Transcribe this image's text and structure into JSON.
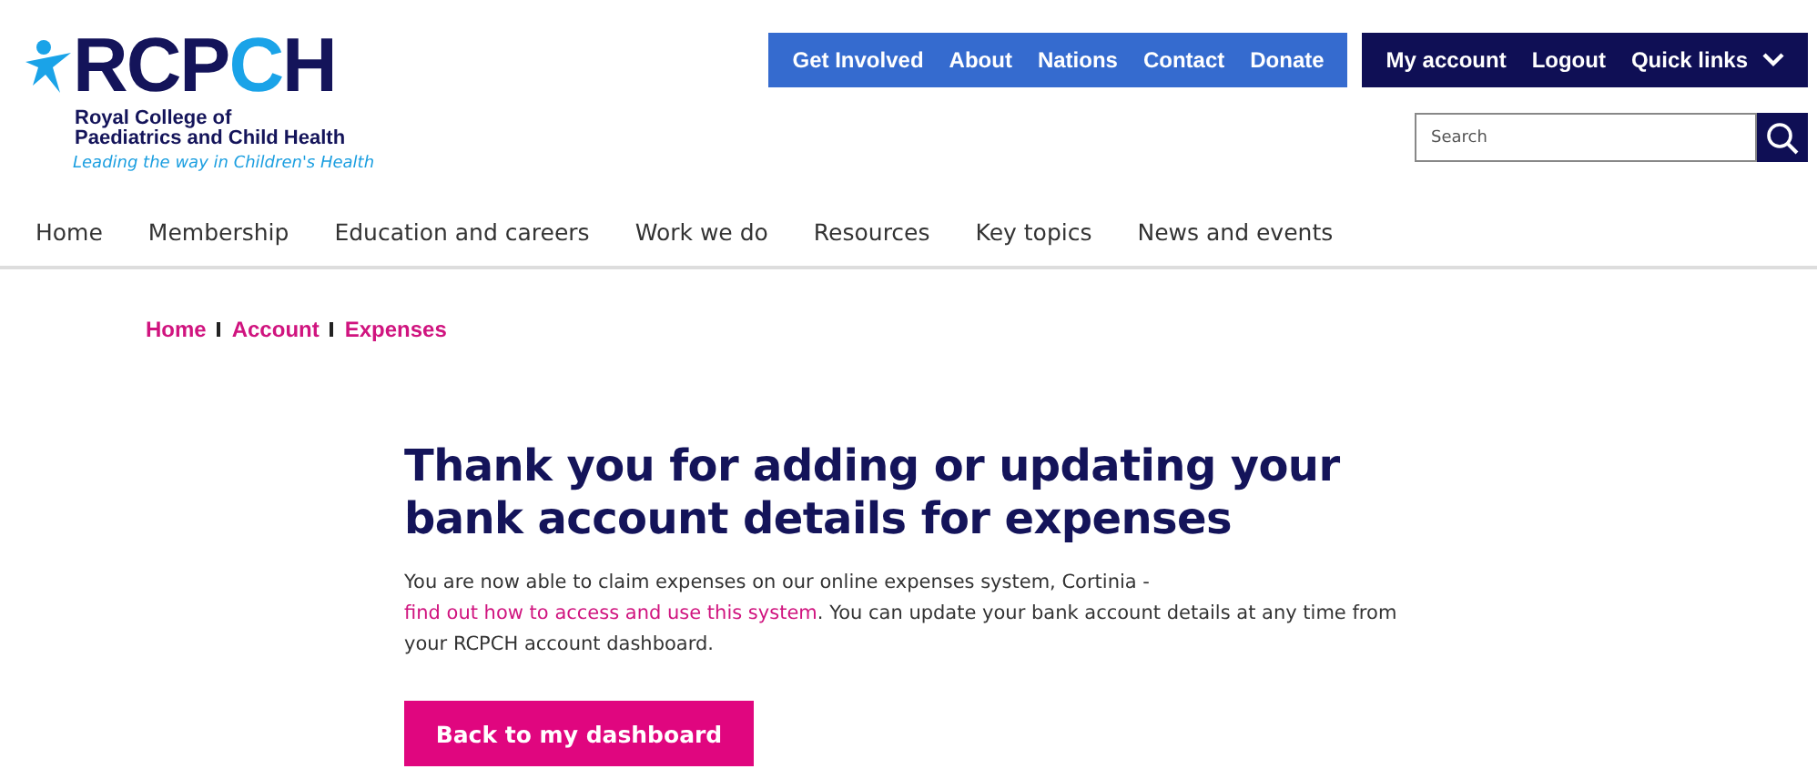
{
  "logo": {
    "letters": [
      {
        "text": "RCP",
        "color": "#14145a"
      },
      {
        "text": "C",
        "color": "#1aa3e8"
      },
      {
        "text": "H",
        "color": "#14145a"
      }
    ],
    "name_lines": [
      "Royal College of",
      "Paediatrics and Child Health"
    ],
    "tagline": "Leading the way in Children's Health"
  },
  "utility_nav": [
    {
      "label": "Get Involved",
      "kind": "primary"
    },
    {
      "label": "About",
      "kind": "primary"
    },
    {
      "label": "Nations",
      "kind": "primary"
    },
    {
      "label": "Contact",
      "kind": "primary"
    },
    {
      "label": "Donate",
      "kind": "primary"
    }
  ],
  "account_nav": [
    {
      "label": "My account",
      "kind": "account"
    },
    {
      "label": "Logout",
      "kind": "logout"
    },
    {
      "label": "Quick links",
      "kind": "dropdown"
    }
  ],
  "search": {
    "placeholder": "Search"
  },
  "main_nav": [
    "Home",
    "Membership",
    "Education and careers",
    "Work we do",
    "Resources",
    "Key topics",
    "News and events"
  ],
  "breadcrumb": [
    "Home",
    "Account",
    "Expenses"
  ],
  "heading": "Thank you for adding or updating your bank account details for expenses",
  "message": {
    "before": "You are now able to claim expenses on our online expenses system, Cortinia - ",
    "link": "find out how to access and use this system",
    "after": ". You can update your bank account details at any time from your RCPCH account dashboard."
  },
  "button": "Back to my dashboard"
}
